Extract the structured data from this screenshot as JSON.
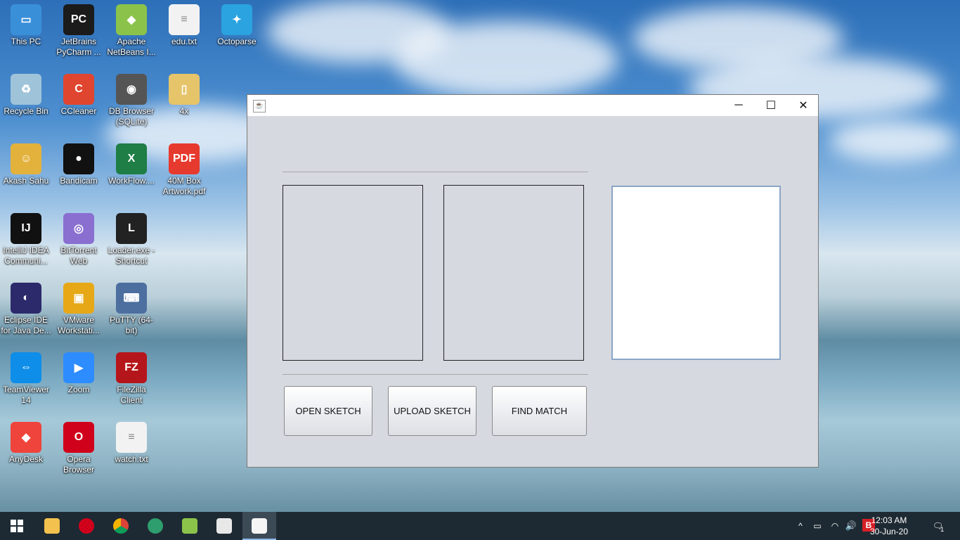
{
  "desktop": {
    "icons": [
      {
        "label": "This PC",
        "glyph": "▭",
        "color": "#3a8fd9"
      },
      {
        "label": "JetBrains PyCharm ...",
        "glyph": "PC",
        "color": "#1b1b1b"
      },
      {
        "label": "Apache NetBeans I...",
        "glyph": "◆",
        "color": "#8bc34a"
      },
      {
        "label": "edu.txt",
        "glyph": "≡",
        "color": "#f2f2f2"
      },
      {
        "label": "Octoparse",
        "glyph": "✦",
        "color": "#2aa3e0"
      },
      {
        "label": "Recycle Bin",
        "glyph": "♻",
        "color": "#9fc3d9"
      },
      {
        "label": "CCleaner",
        "glyph": "C",
        "color": "#e0452f"
      },
      {
        "label": "DB Browser (SQLite)",
        "glyph": "◉",
        "color": "#555"
      },
      {
        "label": "4x",
        "glyph": "▯",
        "color": "#e6c46a"
      },
      {
        "label": "Akash Sahu",
        "glyph": "☺",
        "color": "#e3b23c"
      },
      {
        "label": "Bandicam",
        "glyph": "●",
        "color": "#111"
      },
      {
        "label": "WorkFlow....",
        "glyph": "X",
        "color": "#1e7e45"
      },
      {
        "label": "40M Box Artwork.pdf",
        "glyph": "PDF",
        "color": "#e63a2e"
      },
      {
        "label": "IntelliJ IDEA Communi...",
        "glyph": "IJ",
        "color": "#111"
      },
      {
        "label": "BitTorrent Web",
        "glyph": "◎",
        "color": "#8a6fd1"
      },
      {
        "label": "Loader.exe - Shortcut",
        "glyph": "L",
        "color": "#222"
      },
      {
        "label": "Eclipse IDE for Java De...",
        "glyph": "◐",
        "color": "#2c2a6b"
      },
      {
        "label": "VMware Workstati...",
        "glyph": "▣",
        "color": "#e6a817"
      },
      {
        "label": "PuTTY (64-bit)",
        "glyph": "⌨",
        "color": "#4d6fa0"
      },
      {
        "label": "TeamViewer 14",
        "glyph": "⇔",
        "color": "#0e8ee9"
      },
      {
        "label": "Zoom",
        "glyph": "▶",
        "color": "#2d8cff"
      },
      {
        "label": "FileZilla Client",
        "glyph": "FZ",
        "color": "#b5161b"
      },
      {
        "label": "AnyDesk",
        "glyph": "◆",
        "color": "#ef443b"
      },
      {
        "label": "Opera Browser",
        "glyph": "O",
        "color": "#d0021b"
      },
      {
        "label": "watch.txt",
        "glyph": "≡",
        "color": "#f2f2f2"
      }
    ]
  },
  "window": {
    "title": "",
    "java_icon": "java-cup-icon",
    "controls": {
      "minimize": "─",
      "maximize": "☐",
      "close": "✕"
    },
    "buttons": {
      "open": "OPEN SKETCH",
      "upload": "UPLOAD SKETCH",
      "find": "FIND MATCH"
    }
  },
  "taskbar": {
    "apps": [
      "start",
      "file-explorer",
      "opera",
      "chrome",
      "edge",
      "netbeans",
      "paint",
      "java"
    ],
    "tray": {
      "chevron": "^",
      "battery": "▭",
      "wifi": "◠",
      "volume": "🔊",
      "bandicam": "B"
    },
    "time": "12:03 AM",
    "date": "30-Jun-20",
    "notification_count": "1"
  }
}
